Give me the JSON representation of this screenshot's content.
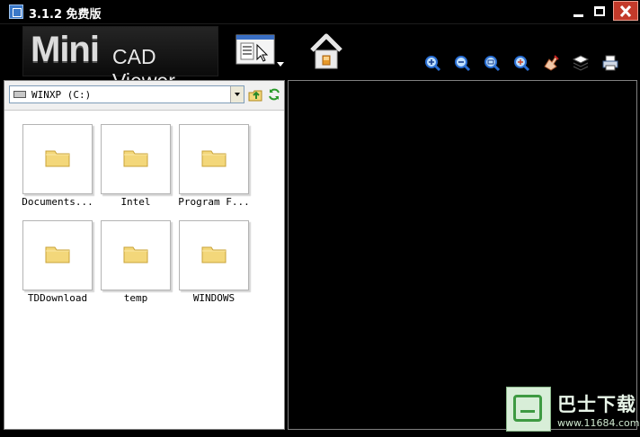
{
  "window": {
    "title": "3.1.2 免费版"
  },
  "logo": {
    "mini": "Mini",
    "cad_viewer": "CAD Viewer"
  },
  "toolbar": {
    "tools": [
      "zoom-in-icon",
      "zoom-out-icon",
      "zoom-fit-icon",
      "zoom-window-icon",
      "pan-icon",
      "layers-icon",
      "print-icon"
    ]
  },
  "drive": {
    "selected": "WINXP (C:)"
  },
  "files": [
    {
      "name": "Documents..."
    },
    {
      "name": "Intel"
    },
    {
      "name": "Program F..."
    },
    {
      "name": "TDDownload"
    },
    {
      "name": "temp"
    },
    {
      "name": "WINDOWS"
    }
  ],
  "watermark": {
    "text": "巴士下载",
    "url": "www.11684.com"
  },
  "colors": {
    "background": "#000000",
    "close": "#c33a2a",
    "folder": "#f3d77a"
  }
}
